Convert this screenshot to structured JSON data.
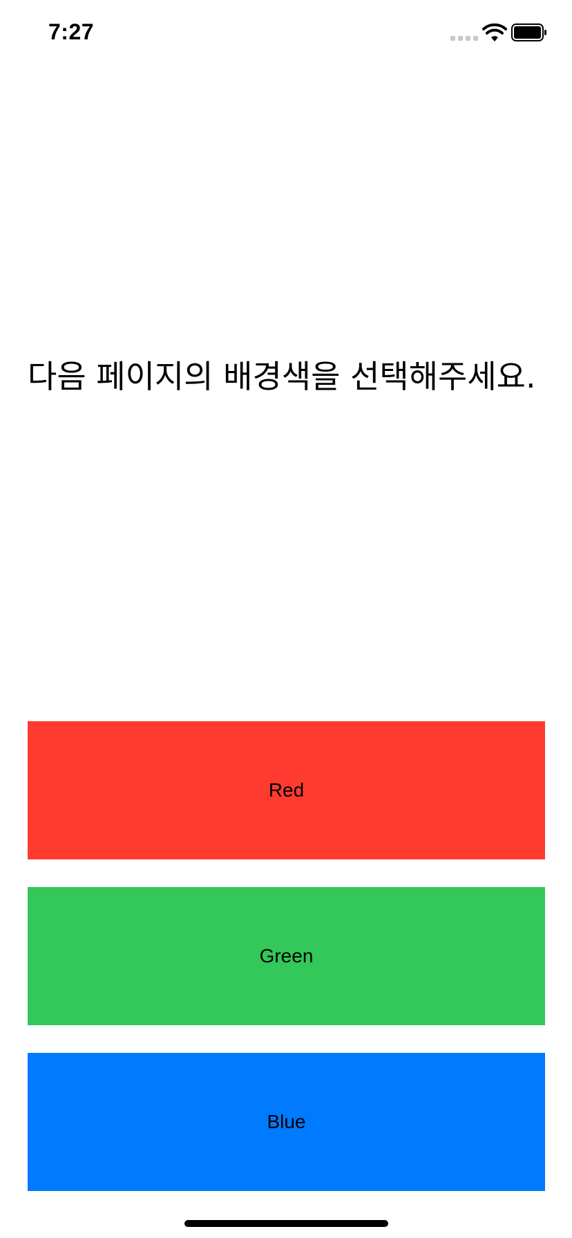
{
  "status_bar": {
    "time": "7:27",
    "signal_icon": "cellular-signal-icon",
    "wifi_icon": "wifi-icon",
    "battery_icon": "battery-icon"
  },
  "main": {
    "instruction": "다음 페이지의 배경색을 선택해주세요."
  },
  "buttons": [
    {
      "label": "Red",
      "color": "#ff3b30"
    },
    {
      "label": "Green",
      "color": "#34c759"
    },
    {
      "label": "Blue",
      "color": "#007aff"
    }
  ]
}
